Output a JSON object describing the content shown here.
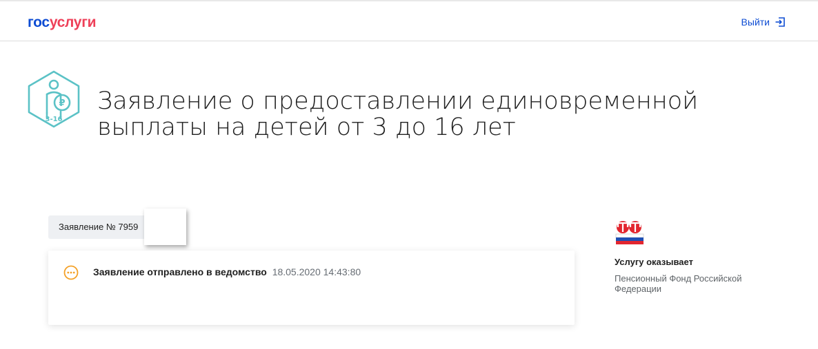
{
  "header": {
    "logo_part1": "гос",
    "logo_part2": "услуги",
    "logout_label": "Выйти",
    "logout_icon": "logout-icon"
  },
  "service": {
    "icon": "child-benefit-icon",
    "icon_badge": "3-16",
    "title_line1": "Заявление о предоставлении единовременной",
    "title_line2": "выплаты на детей от 3 до 16 лет"
  },
  "application": {
    "number_label": "Заявление № 7959"
  },
  "status": {
    "icon": "pending-status-icon",
    "text": "Заявление отправлено в ведомство",
    "timestamp": "18.05.2020 14:43:80"
  },
  "provider": {
    "logo": "pfr-logo",
    "title": "Услугу оказывает",
    "name_line1": "Пенсионный Фонд Российской",
    "name_line2": "Федерации"
  },
  "colors": {
    "brand_blue": "#0d4cd3",
    "brand_red": "#ee3f58",
    "icon_teal": "#5bc2c6",
    "status_orange": "#f4a025",
    "pfr_red": "#e2262f"
  }
}
